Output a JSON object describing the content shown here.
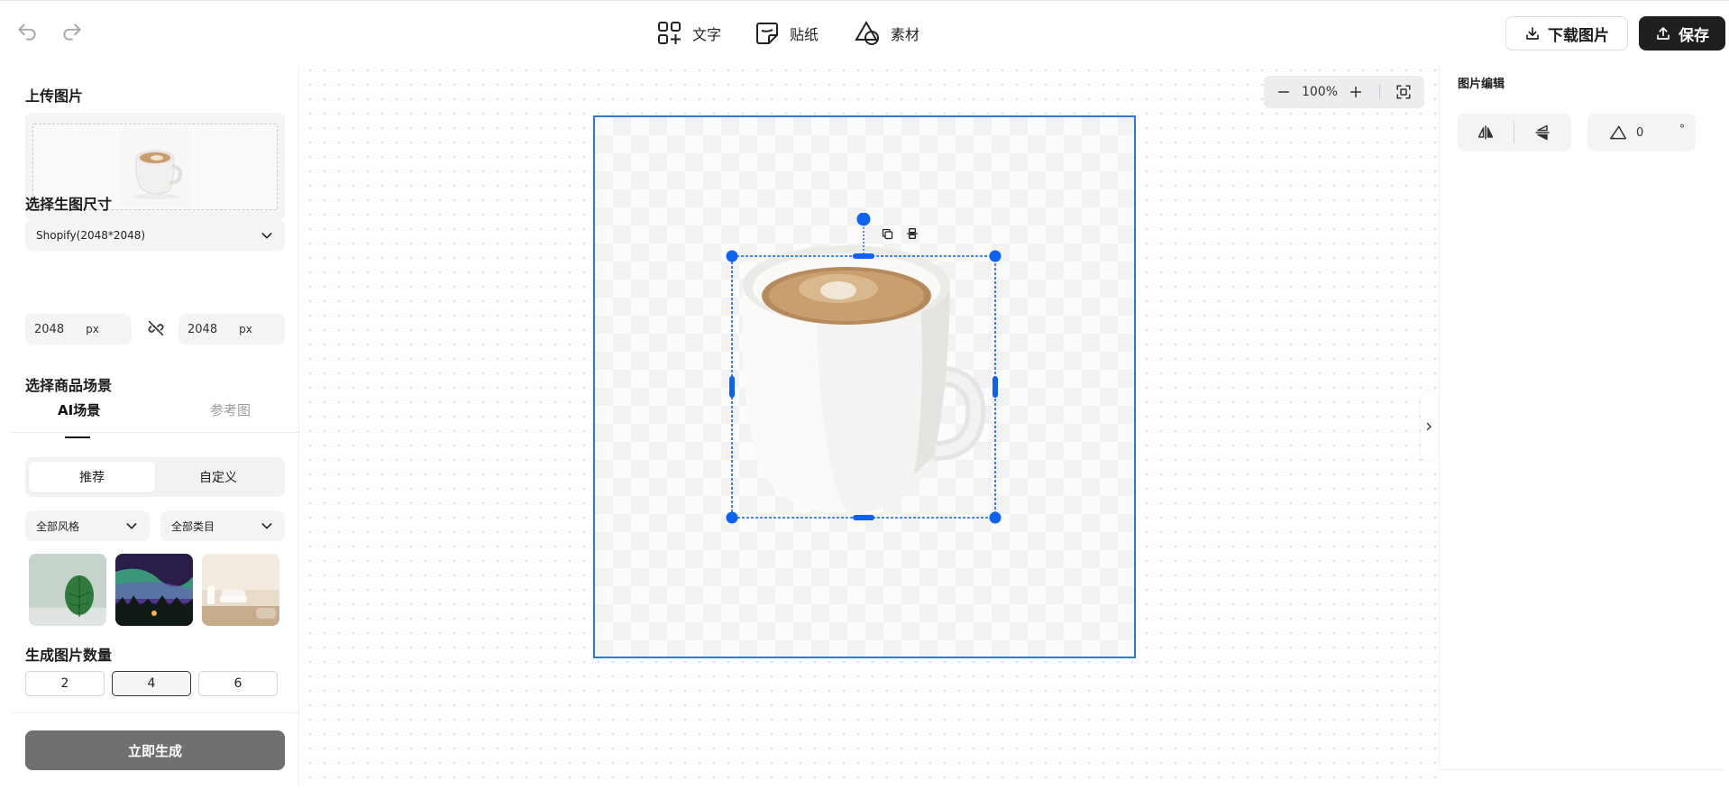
{
  "header": {
    "tools": [
      {
        "label": "文字",
        "icon": "text-add-icon"
      },
      {
        "label": "贴纸",
        "icon": "sticker-icon"
      },
      {
        "label": "素材",
        "icon": "shapes-icon"
      }
    ],
    "download_label": "下载图片",
    "save_label": "保存"
  },
  "left_panel": {
    "upload_title": "上传图片",
    "size_title": "选择生图尺寸",
    "size_select": "Shopify(2048*2048)",
    "width_value": "2048",
    "height_value": "2048",
    "unit": "px",
    "scene_title": "选择商品场景",
    "tabs": [
      "AI场景",
      "参考图"
    ],
    "segments": [
      "推荐",
      "自定义"
    ],
    "filters": [
      "全部风格",
      "全部类目"
    ],
    "count_title": "生成图片数量",
    "counts": [
      "2",
      "4",
      "6"
    ],
    "selected_count": "4",
    "generate_label": "立即生成"
  },
  "canvas": {
    "zoom": "100%"
  },
  "right_panel": {
    "title": "图片编辑",
    "rotation_value": "0",
    "rotation_unit": "°"
  },
  "colors": {
    "accent": "#0e62f0",
    "artboard_border": "#2a7bd8",
    "save_bg": "#1f1f21",
    "generate_bg": "#707070"
  }
}
